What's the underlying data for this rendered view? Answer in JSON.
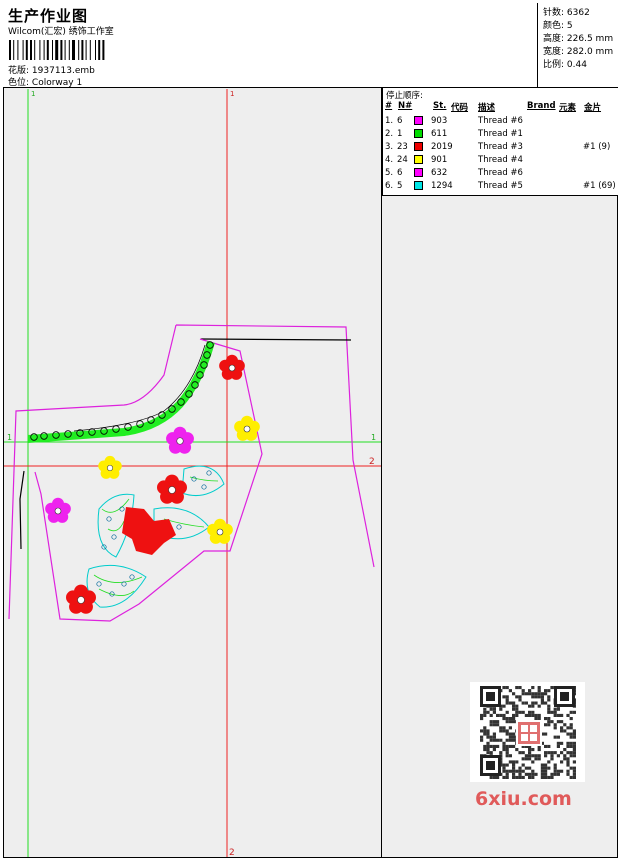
{
  "header": {
    "title": "生产作业图",
    "company": "Wilcom(汇宏) 绣饰工作室",
    "design_label": "花版:",
    "design_file": "1937113.emb",
    "color_label": "色位:",
    "colorway": "Colorway 1"
  },
  "stats": [
    {
      "label": "针数:",
      "value": "6362"
    },
    {
      "label": "颜色:",
      "value": "5"
    },
    {
      "label": "高度:",
      "value": "226.5 mm"
    },
    {
      "label": "宽度:",
      "value": "282.0 mm"
    },
    {
      "label": "比例:",
      "value": "0.44"
    }
  ],
  "stop_sequence": {
    "label": "停止顺序:",
    "columns": [
      "#",
      "N#",
      "St.",
      "代码",
      "描述",
      "Brand",
      "元素",
      "金片"
    ],
    "rows": [
      {
        "idx": "1.",
        "n": "6",
        "color": "#ff00ff",
        "st": "903",
        "desc": "Thread #6",
        "extra": ""
      },
      {
        "idx": "2.",
        "n": "1",
        "color": "#00dd00",
        "st": "611",
        "desc": "Thread #1",
        "extra": ""
      },
      {
        "idx": "3.",
        "n": "23",
        "color": "#ee0000",
        "st": "2019",
        "desc": "Thread #3",
        "extra": "#1 (9)"
      },
      {
        "idx": "4.",
        "n": "24",
        "color": "#ffff00",
        "st": "901",
        "desc": "Thread #4",
        "extra": ""
      },
      {
        "idx": "5.",
        "n": "6",
        "color": "#ff00ff",
        "st": "632",
        "desc": "Thread #6",
        "extra": ""
      },
      {
        "idx": "6.",
        "n": "5",
        "color": "#00e5e5",
        "st": "1294",
        "desc": "Thread #5",
        "extra": "#1 (69)"
      }
    ]
  },
  "guides": {
    "v1_top": "1",
    "v2_top": "1",
    "h1_left": "1",
    "h1_right": "1",
    "h2_right": "2",
    "v2_bottom": "2"
  },
  "watermark": "6xiu.com"
}
